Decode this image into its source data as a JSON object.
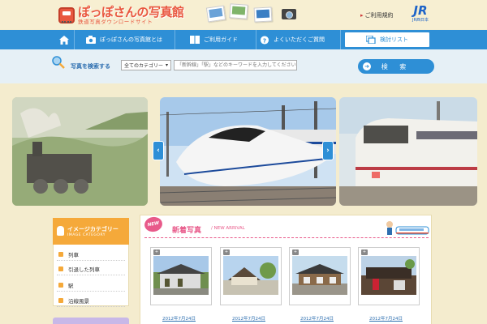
{
  "header": {
    "logo_main": "ぽっぽさんの写真館",
    "logo_sub": "鉄道写真ダウンロードサイト",
    "terms_link": "ご利用規約",
    "jr_logo": "JR",
    "jr_sub": "JR西日本"
  },
  "nav": {
    "items": [
      {
        "label": "ぽっぽさんの写真館とは",
        "icon": "camera-icon"
      },
      {
        "label": "ご利用ガイド",
        "icon": "book-icon"
      },
      {
        "label": "よくいただくご質問",
        "icon": "question-icon"
      },
      {
        "label": "検討リスト",
        "icon": "list-icon"
      }
    ]
  },
  "search": {
    "label": "写真を検索する",
    "category_value": "全てのカテゴリー",
    "keyword_placeholder": "「新幹線」「駅」などのキーワードを入力してください",
    "button_label": "検 索"
  },
  "sidebar": {
    "title": "イメージカテゴリー",
    "subtitle": "IMAGE CATEGORY",
    "items": [
      {
        "label": "列車"
      },
      {
        "label": "引退した列車"
      },
      {
        "label": "駅"
      },
      {
        "label": "沿線風景"
      }
    ]
  },
  "main": {
    "badge": "NEW",
    "title": "新着写真",
    "subtitle": "/ NEW ARRIVAL",
    "photos": [
      {
        "date": "2012年7月24日"
      },
      {
        "date": "2012年7月24日"
      },
      {
        "date": "2012年7月24日"
      },
      {
        "date": "2012年7月24日"
      }
    ]
  },
  "colors": {
    "brand_blue": "#2e8fd6",
    "logo_red": "#e9573f",
    "accent_orange": "#f5a93a",
    "new_pink": "#e85a8a"
  }
}
